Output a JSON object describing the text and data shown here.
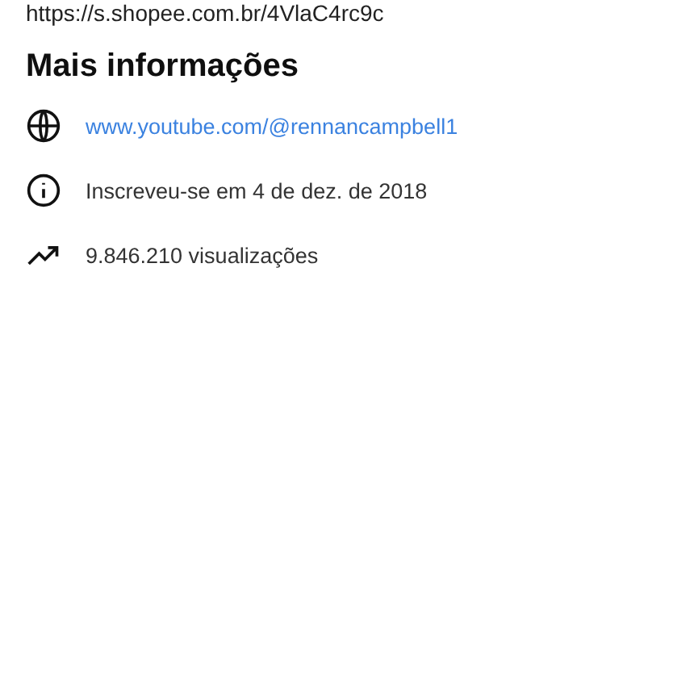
{
  "top_link": "https://s.shopee.com.br/4VlaC4rc9c",
  "section_title": "Mais informações",
  "rows": [
    {
      "kind": "website",
      "text": "www.youtube.com/@rennancampbell1"
    },
    {
      "kind": "joined",
      "text": "Inscreveu-se em 4 de dez. de 2018"
    },
    {
      "kind": "views",
      "text": "9.846.210 visualizações"
    }
  ]
}
